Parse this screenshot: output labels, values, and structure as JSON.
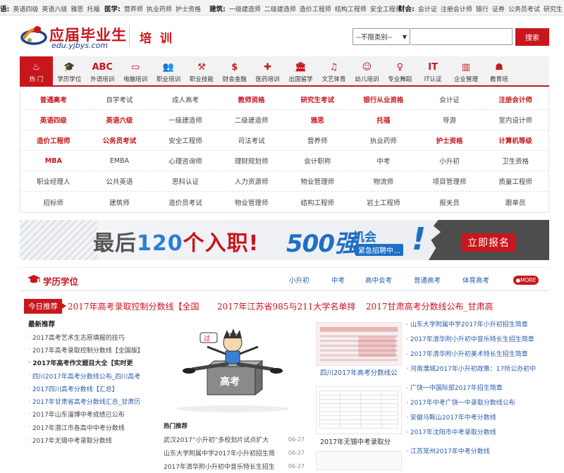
{
  "topbar": {
    "groups": [
      {
        "head": "语:",
        "items": [
          "英语四级",
          "英语六级",
          "雅思",
          "托福"
        ]
      },
      {
        "head": "医学:",
        "items": [
          "营养师",
          "执业药师",
          "护士资格"
        ]
      },
      {
        "head": "建筑:",
        "items": [
          "一级建造师",
          "二级建造师",
          "造价工程师",
          "结构工程师",
          "安全工程师"
        ]
      },
      {
        "head": "财会:",
        "items": [
          "会计证",
          "注册会计师",
          "银行",
          "证券",
          "公务员考试",
          "研究生"
        ]
      }
    ]
  },
  "header": {
    "logo_cn": "应届毕业生",
    "logo_en": "edu.yjbys.com",
    "section": "培 训",
    "search_select": "--不限类别--",
    "search_placeholder": "",
    "search_button": "搜索"
  },
  "catnav": [
    {
      "label": "热 门",
      "icon": "flame-icon",
      "glyph": "♨"
    },
    {
      "label": "学历学位",
      "icon": "graduation-cap-icon",
      "glyph": "🎓"
    },
    {
      "label": "外语培训",
      "icon": "abc-icon",
      "glyph": "ABC"
    },
    {
      "label": "电脑培训",
      "icon": "monitor-icon",
      "glyph": "▭"
    },
    {
      "label": "职业培训",
      "icon": "people-icon",
      "glyph": "👥"
    },
    {
      "label": "职业技能",
      "icon": "worker-icon",
      "glyph": "⚒"
    },
    {
      "label": "财会金融",
      "icon": "money-bag-icon",
      "glyph": "$"
    },
    {
      "label": "医药培训",
      "icon": "medical-kit-icon",
      "glyph": "✚"
    },
    {
      "label": "出国留学",
      "icon": "building-icon",
      "glyph": "🏛"
    },
    {
      "label": "文艺体育",
      "icon": "guitar-icon",
      "glyph": "♫"
    },
    {
      "label": "幼儿培训",
      "icon": "rattle-icon",
      "glyph": "☺"
    },
    {
      "label": "专业舞蹈",
      "icon": "dancer-icon",
      "glyph": "♀"
    },
    {
      "label": "IT认证",
      "icon": "it-icon",
      "glyph": "IT"
    },
    {
      "label": "企业管理",
      "icon": "bar-chart-icon",
      "glyph": "▥"
    },
    {
      "label": "教育培",
      "icon": "teacher-icon",
      "glyph": "☗"
    }
  ],
  "hot_grid": [
    [
      {
        "t": "普通高考",
        "h": true
      },
      {
        "t": "自学考试"
      },
      {
        "t": "成人高考"
      },
      {
        "t": "教师资格",
        "h": true
      },
      {
        "t": "研究生考试",
        "h": true
      },
      {
        "t": "银行从业资格",
        "h": true
      },
      {
        "t": "会计证"
      },
      {
        "t": "注册会计师",
        "h": true
      }
    ],
    [
      {
        "t": "英语四级",
        "h": true
      },
      {
        "t": "英语六级",
        "h": true
      },
      {
        "t": "一级建造师"
      },
      {
        "t": "二级建造师"
      },
      {
        "t": "雅思",
        "h": true
      },
      {
        "t": "托福",
        "h": true
      },
      {
        "t": "导游"
      },
      {
        "t": "室内设计师"
      }
    ],
    [
      {
        "t": "造价工程师",
        "h": true
      },
      {
        "t": "公务员考试",
        "h": true
      },
      {
        "t": "安全工程师"
      },
      {
        "t": "司法考试"
      },
      {
        "t": "营养师"
      },
      {
        "t": "执业药师"
      },
      {
        "t": "护士资格",
        "h": true
      },
      {
        "t": "计算机等级",
        "h": true
      }
    ],
    [
      {
        "t": "MBA",
        "h": true
      },
      {
        "t": "EMBA"
      },
      {
        "t": "心理咨询师"
      },
      {
        "t": "理财规划师"
      },
      {
        "t": "会计职称"
      },
      {
        "t": "中考"
      },
      {
        "t": "小升初"
      },
      {
        "t": "卫生资格"
      }
    ],
    [
      {
        "t": "职业经理人"
      },
      {
        "t": "公共英语"
      },
      {
        "t": "思科认证"
      },
      {
        "t": "人力资源师"
      },
      {
        "t": "物业管理师"
      },
      {
        "t": "物流师"
      },
      {
        "t": "项目管理师"
      },
      {
        "t": "质量工程师"
      }
    ],
    [
      {
        "t": "招标师"
      },
      {
        "t": "建筑师"
      },
      {
        "t": "造价员考试"
      },
      {
        "t": "物业管理师"
      },
      {
        "t": "结构工程师"
      },
      {
        "t": "岩土工程师"
      },
      {
        "t": "报关员"
      },
      {
        "t": "跟单员"
      }
    ]
  ],
  "banner": {
    "text_a": "最后",
    "text_num": "120",
    "text_b": "个入职!",
    "big_num": "500强",
    "mark": "机会",
    "sub": "紧急招聘中…",
    "excl": "!",
    "button": "立即报名"
  },
  "section": {
    "title": "学历学位",
    "tabs": [
      "小升初",
      "中考",
      "高中会考",
      "普通高考",
      "体育高考"
    ],
    "more": "MORE"
  },
  "today": {
    "badge": "今日推荐",
    "links": [
      "2017年高考录取控制分数线【全国",
      "2017年江苏省985与211大学名单排",
      "2017甘肃高考分数线公布_甘肃高"
    ]
  },
  "latest": {
    "title": "最新推荐",
    "items": [
      {
        "t": "2017高考艺术生志愿填报的技巧",
        "s": ""
      },
      {
        "t": "2017年高考录取控制分数线【全国版】",
        "s": ""
      },
      {
        "t": "2017年高考作文题目大全【实时更",
        "s": "bold"
      },
      {
        "t": "四川2017年高考分数线公布_四川高考",
        "s": "blue"
      },
      {
        "t": "2017四川高考分数线【汇总】",
        "s": "blue"
      },
      {
        "t": "2017年甘肃省高考分数线汇总_甘肃历",
        "s": "blue"
      },
      {
        "t": "2017年山东淄博中考成绩已公布",
        "s": ""
      },
      {
        "t": "2017年潜江市各高中中考分数线",
        "s": ""
      },
      {
        "t": "2017年无锡中考录取分数线",
        "s": ""
      }
    ]
  },
  "hot": {
    "title": "热门推荐",
    "items": [
      {
        "t": "武汉2017“小升初”多校划片试点扩大",
        "d": "06-27"
      },
      {
        "t": "山东大学附属中学2017年小升初招生简",
        "d": "06-27"
      },
      {
        "t": "2017年清华附小升初中音乐特长生招生",
        "d": "06-27"
      }
    ]
  },
  "images": {
    "cap1": "四川2017年高考分数线公",
    "cap2": "2017年无锡中考录取分"
  },
  "right_list": [
    "山东大学附属中学2017年小升初招生简章",
    "2017年清华附小升初中音乐特长生招生简章",
    "2017年清华附小升初美术特长生招生简章",
    "河南濮城2017年小升初政策：17所公办初中",
    "广饶一中国际部2017年招生简章",
    "2017年中考广饶一中录取分数线公布",
    "安徽马鞍山2017年中考分数线",
    "2017年沈阳市中考录取分数线",
    "江苏常州2017年中考分数线"
  ],
  "colors": {
    "brand": "#c8161d",
    "link": "#2a5ca8",
    "banner_blue": "#1f6fc5"
  }
}
